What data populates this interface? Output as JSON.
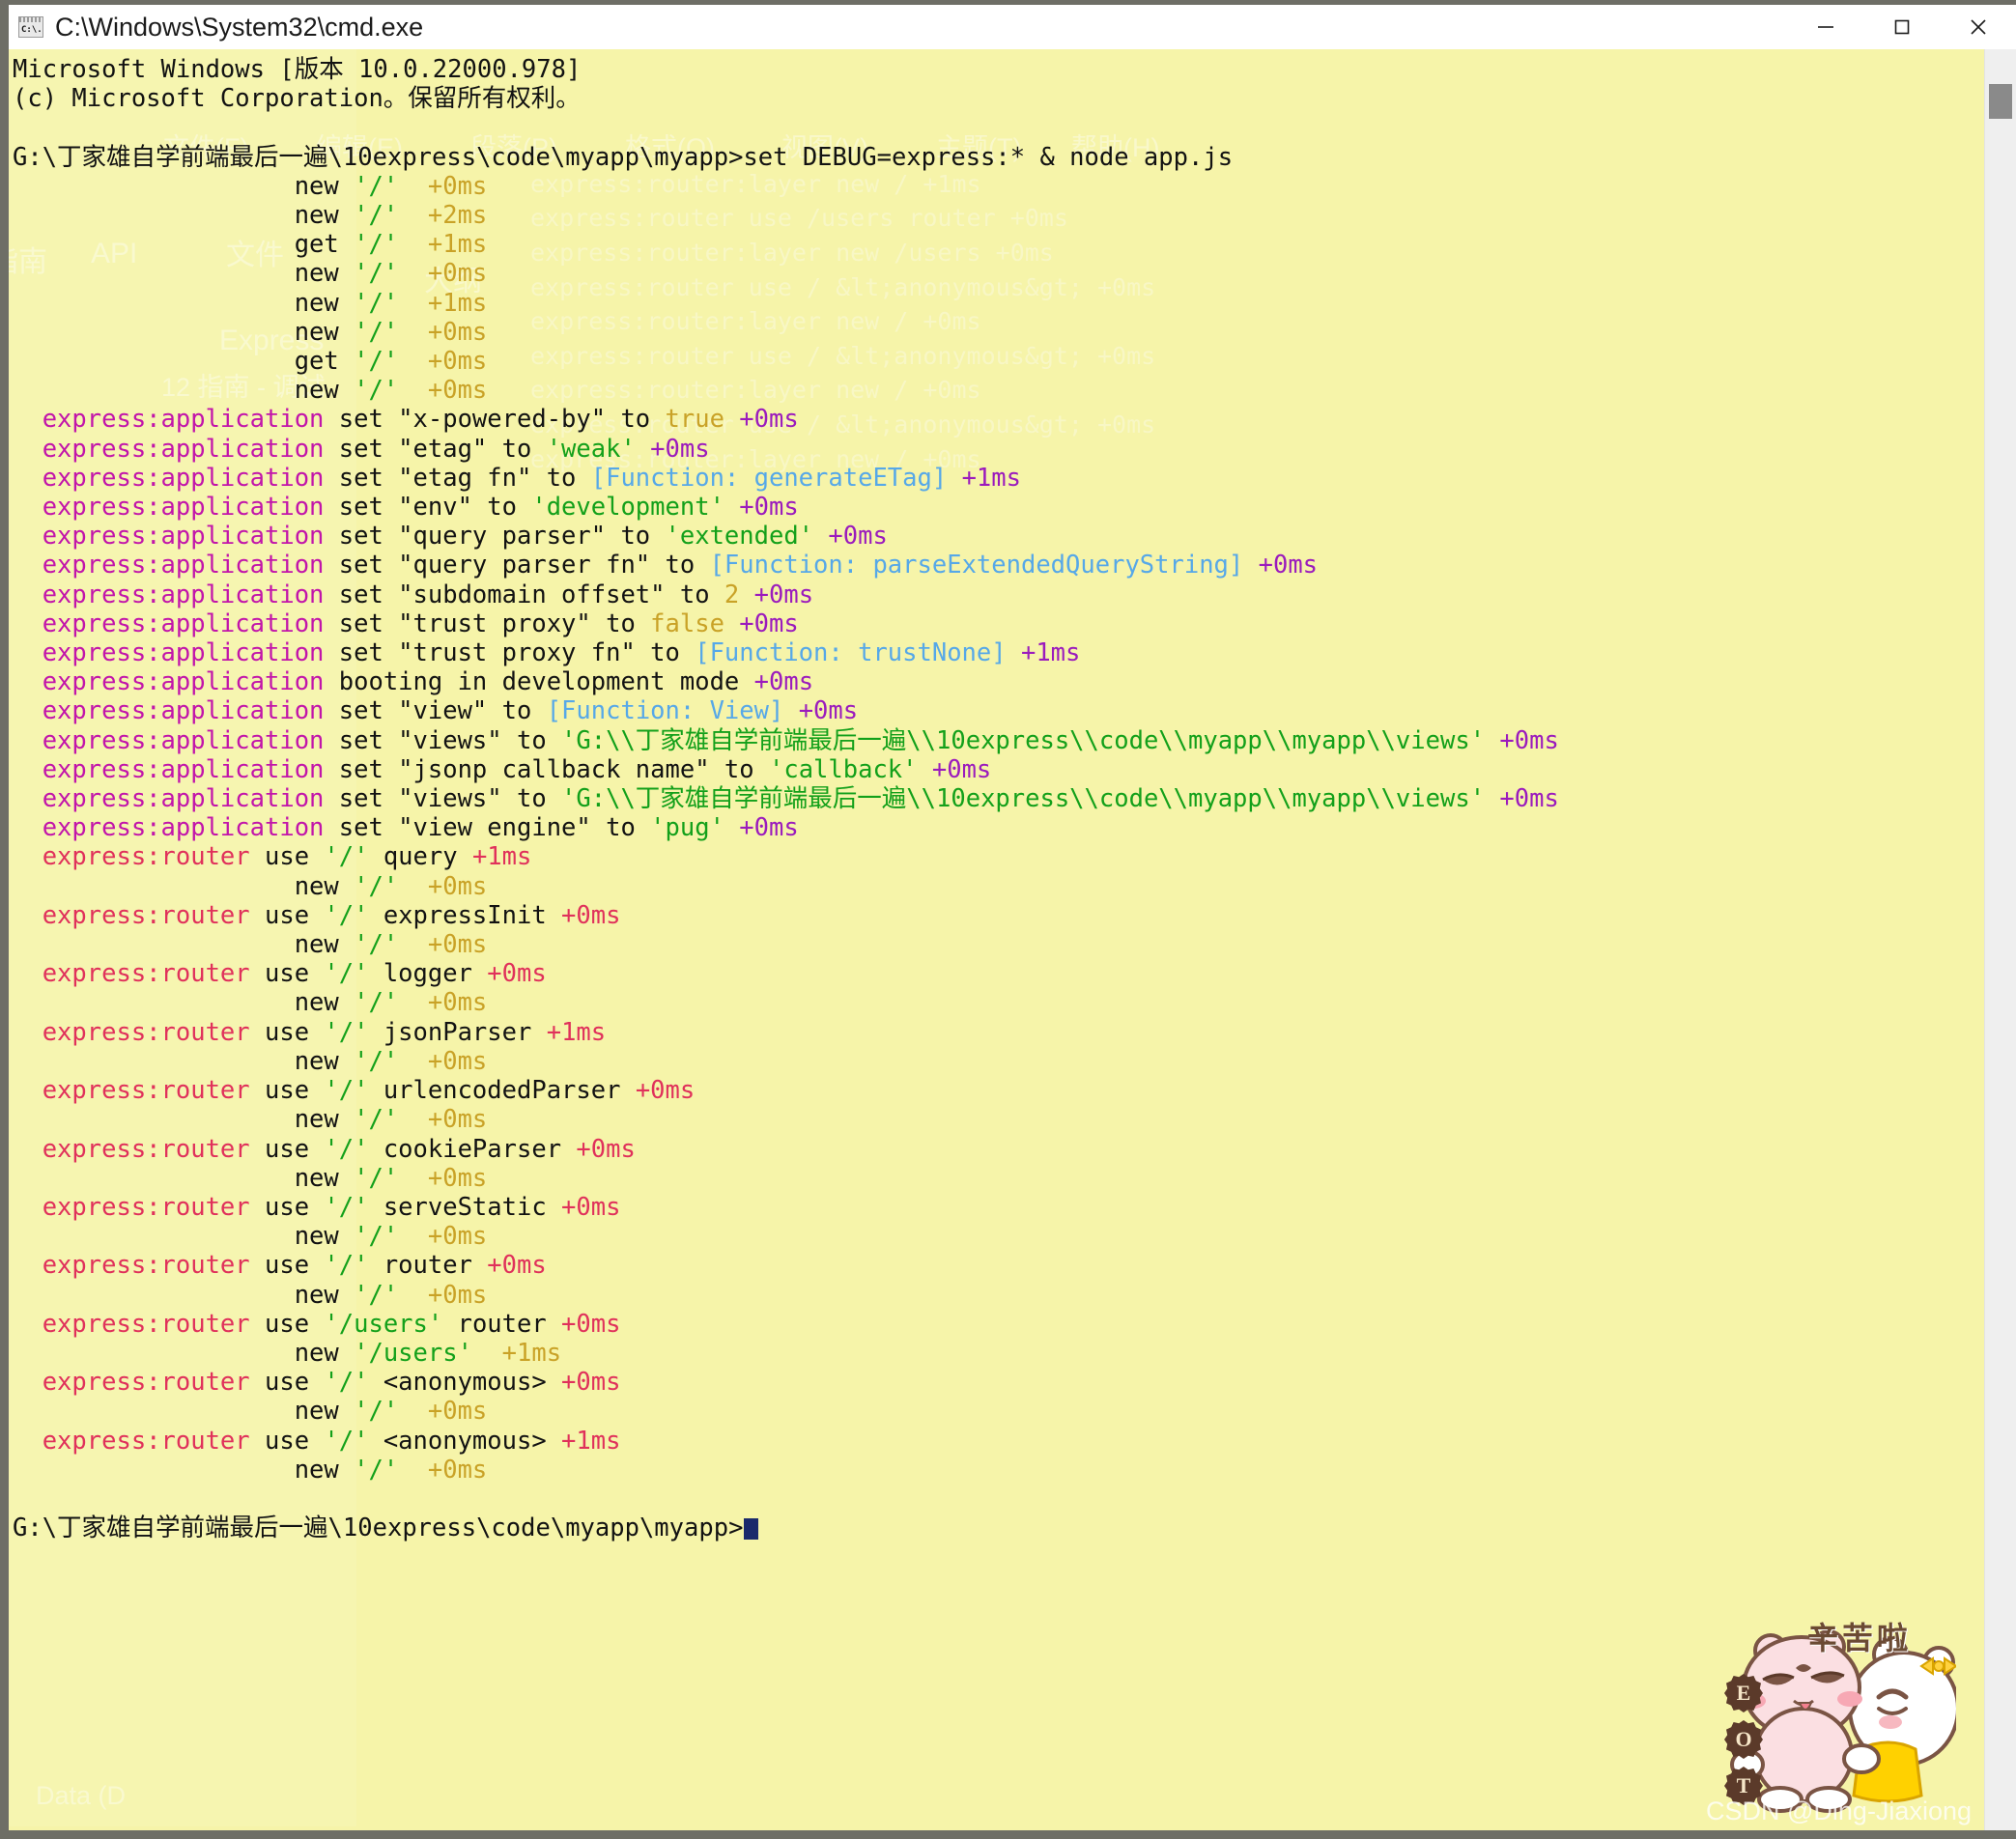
{
  "window": {
    "title": "C:\\Windows\\System32\\cmd.exe",
    "icon": "cmd-icon",
    "controls": {
      "minimize": "—",
      "maximize": "☐",
      "close": "✕"
    }
  },
  "colors": {
    "background": "#f6f4a9",
    "text": "#121212",
    "application_namespace": "#c215aa",
    "router_namespace": "#e0315b",
    "string": "#13a01a",
    "function": "#56a8e8",
    "number_bool": "#c9a227",
    "timing_gold": "#c9a227",
    "titlebar": "#ffffff",
    "frame": "#6e6e66",
    "scrollbar_track": "#efefef",
    "scrollbar_thumb": "#8a8a8a"
  },
  "console": {
    "header": [
      "Microsoft Windows [版本 10.0.22000.978]",
      "(c) Microsoft Corporation。保留所有权利。"
    ],
    "prompt_path": "G:\\丁家雄自学前端最后一遍\\10express\\code\\myapp\\myapp>",
    "command": "set DEBUG=express:* & node app.js",
    "final_prompt": "G:\\丁家雄自学前端最后一遍\\10express\\code\\myapp\\myapp>",
    "lines": [
      {
        "type": "indent",
        "verb": "new",
        "path": "'/'",
        "timing": "+0ms"
      },
      {
        "type": "indent",
        "verb": "new",
        "path": "'/'",
        "timing": "+2ms"
      },
      {
        "type": "indent",
        "verb": "get",
        "path": "'/'",
        "timing": "+1ms"
      },
      {
        "type": "indent",
        "verb": "new",
        "path": "'/'",
        "timing": "+0ms"
      },
      {
        "type": "indent",
        "verb": "new",
        "path": "'/'",
        "timing": "+1ms"
      },
      {
        "type": "indent",
        "verb": "new",
        "path": "'/'",
        "timing": "+0ms"
      },
      {
        "type": "indent",
        "verb": "get",
        "path": "'/'",
        "timing": "+0ms"
      },
      {
        "type": "indent",
        "verb": "new",
        "path": "'/'",
        "timing": "+0ms"
      },
      {
        "type": "app",
        "ns": "express:application",
        "verb": "set",
        "key": "\"x-powered-by\"",
        "to": "to",
        "value": "true",
        "vkind": "bool",
        "timing": "+0ms"
      },
      {
        "type": "app",
        "ns": "express:application",
        "verb": "set",
        "key": "\"etag\"",
        "to": "to",
        "value": "'weak'",
        "vkind": "str",
        "timing": "+0ms"
      },
      {
        "type": "app",
        "ns": "express:application",
        "verb": "set",
        "key": "\"etag fn\"",
        "to": "to",
        "value": "[Function: generateETag]",
        "vkind": "fn",
        "timing": "+1ms"
      },
      {
        "type": "app",
        "ns": "express:application",
        "verb": "set",
        "key": "\"env\"",
        "to": "to",
        "value": "'development'",
        "vkind": "str",
        "timing": "+0ms"
      },
      {
        "type": "app",
        "ns": "express:application",
        "verb": "set",
        "key": "\"query parser\"",
        "to": "to",
        "value": "'extended'",
        "vkind": "str",
        "timing": "+0ms"
      },
      {
        "type": "app",
        "ns": "express:application",
        "verb": "set",
        "key": "\"query parser fn\"",
        "to": "to",
        "value": "[Function: parseExtendedQueryString]",
        "vkind": "fn",
        "timing": "+0ms"
      },
      {
        "type": "app",
        "ns": "express:application",
        "verb": "set",
        "key": "\"subdomain offset\"",
        "to": "to",
        "value": "2",
        "vkind": "num",
        "timing": "+0ms"
      },
      {
        "type": "app",
        "ns": "express:application",
        "verb": "set",
        "key": "\"trust proxy\"",
        "to": "to",
        "value": "false",
        "vkind": "bool",
        "timing": "+0ms"
      },
      {
        "type": "app",
        "ns": "express:application",
        "verb": "set",
        "key": "\"trust proxy fn\"",
        "to": "to",
        "value": "[Function: trustNone]",
        "vkind": "fn",
        "timing": "+1ms"
      },
      {
        "type": "app-plain",
        "ns": "express:application",
        "text": "booting in development mode",
        "timing": "+0ms"
      },
      {
        "type": "app",
        "ns": "express:application",
        "verb": "set",
        "key": "\"view\"",
        "to": "to",
        "value": "[Function: View]",
        "vkind": "fn",
        "timing": "+0ms"
      },
      {
        "type": "app",
        "ns": "express:application",
        "verb": "set",
        "key": "\"views\"",
        "to": "to",
        "value": "'G:\\\\丁家雄自学前端最后一遍\\\\10express\\\\code\\\\myapp\\\\myapp\\\\views'",
        "vkind": "str",
        "timing": "+0ms"
      },
      {
        "type": "app",
        "ns": "express:application",
        "verb": "set",
        "key": "\"jsonp callback name\"",
        "to": "to",
        "value": "'callback'",
        "vkind": "str",
        "timing": "+0ms"
      },
      {
        "type": "app",
        "ns": "express:application",
        "verb": "set",
        "key": "\"views\"",
        "to": "to",
        "value": "'G:\\\\丁家雄自学前端最后一遍\\\\10express\\\\code\\\\myapp\\\\myapp\\\\views'",
        "vkind": "str",
        "timing": "+0ms"
      },
      {
        "type": "app",
        "ns": "express:application",
        "verb": "set",
        "key": "\"view engine\"",
        "to": "to",
        "value": "'pug'",
        "vkind": "str",
        "timing": "+0ms"
      },
      {
        "type": "router",
        "ns": "express:router",
        "verb": "use",
        "path": "'/'",
        "handler": "query",
        "timing": "+1ms"
      },
      {
        "type": "indent",
        "verb": "new",
        "path": "'/'",
        "timing": "+0ms"
      },
      {
        "type": "router",
        "ns": "express:router",
        "verb": "use",
        "path": "'/'",
        "handler": "expressInit",
        "timing": "+0ms"
      },
      {
        "type": "indent",
        "verb": "new",
        "path": "'/'",
        "timing": "+0ms"
      },
      {
        "type": "router",
        "ns": "express:router",
        "verb": "use",
        "path": "'/'",
        "handler": "logger",
        "timing": "+0ms"
      },
      {
        "type": "indent",
        "verb": "new",
        "path": "'/'",
        "timing": "+0ms"
      },
      {
        "type": "router",
        "ns": "express:router",
        "verb": "use",
        "path": "'/'",
        "handler": "jsonParser",
        "timing": "+1ms"
      },
      {
        "type": "indent",
        "verb": "new",
        "path": "'/'",
        "timing": "+0ms"
      },
      {
        "type": "router",
        "ns": "express:router",
        "verb": "use",
        "path": "'/'",
        "handler": "urlencodedParser",
        "timing": "+0ms"
      },
      {
        "type": "indent",
        "verb": "new",
        "path": "'/'",
        "timing": "+0ms"
      },
      {
        "type": "router",
        "ns": "express:router",
        "verb": "use",
        "path": "'/'",
        "handler": "cookieParser",
        "timing": "+0ms"
      },
      {
        "type": "indent",
        "verb": "new",
        "path": "'/'",
        "timing": "+0ms"
      },
      {
        "type": "router",
        "ns": "express:router",
        "verb": "use",
        "path": "'/'",
        "handler": "serveStatic",
        "timing": "+0ms"
      },
      {
        "type": "indent",
        "verb": "new",
        "path": "'/'",
        "timing": "+0ms"
      },
      {
        "type": "router",
        "ns": "express:router",
        "verb": "use",
        "path": "'/'",
        "handler": "router",
        "timing": "+0ms"
      },
      {
        "type": "indent",
        "verb": "new",
        "path": "'/'",
        "timing": "+0ms"
      },
      {
        "type": "router",
        "ns": "express:router",
        "verb": "use",
        "path": "'/users'",
        "handler": "router",
        "timing": "+0ms"
      },
      {
        "type": "indent",
        "verb": "new",
        "path": "'/users'",
        "timing": "+1ms"
      },
      {
        "type": "router",
        "ns": "express:router",
        "verb": "use",
        "path": "'/'",
        "handler": "<anonymous>",
        "timing": "+0ms"
      },
      {
        "type": "indent",
        "verb": "new",
        "path": "'/'",
        "timing": "+0ms"
      },
      {
        "type": "router",
        "ns": "express:router",
        "verb": "use",
        "path": "'/'",
        "handler": "<anonymous>",
        "timing": "+1ms"
      },
      {
        "type": "indent",
        "verb": "new",
        "path": "'/'",
        "timing": "+0ms"
      }
    ]
  },
  "ghost_background": {
    "menu": [
      "文件(F)",
      "编辑(E)",
      "段落(P)",
      "格式(O)",
      "视图(V)",
      "主题(T)",
      "帮助(H)"
    ],
    "sidebar": [
      "指南",
      "API",
      "Express",
      "12 指南 - 调试",
      "Data (D"
    ],
    "columns": [
      "文件",
      "大纲"
    ],
    "code_lines": [
      "express:router:layer new / +1ms",
      "express:router use /users router +0ms",
      "express:router:layer new /users +0ms",
      "express:router use / &lt;anonymous&gt; +0ms",
      "express:router:layer new / +0ms",
      "express:router use / &lt;anonymous&gt; +0ms",
      "express:router:layer new / +0ms"
    ]
  },
  "mascot": {
    "caption": "辛苦啦",
    "badges": [
      "E",
      "O",
      "T"
    ],
    "watermark": "CSDN @Ding-Jiaxiong"
  }
}
